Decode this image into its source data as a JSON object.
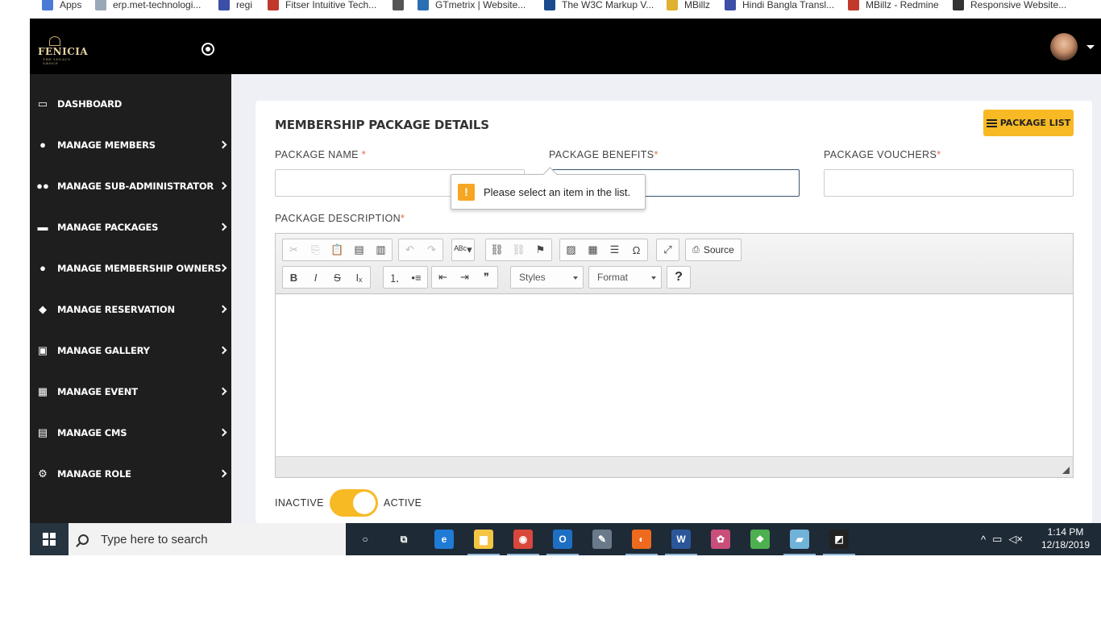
{
  "bookmarks": [
    {
      "label": "Apps",
      "icon": "apps-grid-icon",
      "color": "#4a7bd6"
    },
    {
      "label": "erp.met-technologi...",
      "icon": "page-icon",
      "color": "#9aa7b8"
    },
    {
      "label": "regi",
      "icon": "m-logo-icon",
      "color": "#3c4ea8"
    },
    {
      "label": "Fitser Intuitive Tech...",
      "icon": "redmine-icon",
      "color": "#c0392b"
    },
    {
      "label": "",
      "icon": "globe-icon",
      "color": "#555555"
    },
    {
      "label": "GTmetrix | Website...",
      "icon": "gtmetrix-icon",
      "color": "#2a6fb4"
    },
    {
      "label": "The W3C Markup V...",
      "icon": "w3c-icon",
      "color": "#1a4b8c"
    },
    {
      "label": "MBillz",
      "icon": "mbillz-icon",
      "color": "#e0b030"
    },
    {
      "label": "Hindi Bangla Transl...",
      "icon": "translate-icon",
      "color": "#3c4ea8"
    },
    {
      "label": "MBillz - Redmine",
      "icon": "redmine-icon",
      "color": "#c0392b"
    },
    {
      "label": "Responsive Website...",
      "icon": "responsive-icon",
      "color": "#333333"
    }
  ],
  "header": {
    "logo_text": "FENICIA",
    "logo_sub": "THE LEGACY GROUP"
  },
  "sidebar": {
    "items": [
      {
        "label": "DASHBOARD",
        "icon": "monitor-icon",
        "glyph": "▭",
        "has_arrow": false
      },
      {
        "label": "MANAGE MEMBERS",
        "icon": "user-icon",
        "glyph": "●",
        "has_arrow": true
      },
      {
        "label": "MANAGE SUB-ADMINISTRATOR",
        "icon": "users-icon",
        "glyph": "●●",
        "has_arrow": true
      },
      {
        "label": "MANAGE PACKAGES",
        "icon": "credit-card-icon",
        "glyph": "▬",
        "has_arrow": true
      },
      {
        "label": "MANAGE MEMBERSHIP OWNERS",
        "icon": "user-icon",
        "glyph": "●",
        "has_arrow": true
      },
      {
        "label": "MANAGE RESERVATION",
        "icon": "ticket-icon",
        "glyph": "◆",
        "has_arrow": true
      },
      {
        "label": "MANAGE GALLERY",
        "icon": "image-icon",
        "glyph": "▣",
        "has_arrow": true
      },
      {
        "label": "MANAGE EVENT",
        "icon": "calendar-icon",
        "glyph": "▦",
        "has_arrow": true
      },
      {
        "label": "MANAGE CMS",
        "icon": "file-icon",
        "glyph": "▤",
        "has_arrow": true
      },
      {
        "label": "MANAGE ROLE",
        "icon": "cogs-icon",
        "glyph": "⚙",
        "has_arrow": true
      }
    ]
  },
  "main": {
    "title": "MEMBERSHIP PACKAGE DETAILS",
    "package_list_label": "PACKAGE LIST",
    "fields": {
      "package_name": {
        "label": "PACKAGE NAME",
        "req": "*",
        "value": ""
      },
      "package_benefits": {
        "label": "PACKAGE BENEFITS",
        "req": "*",
        "value": ""
      },
      "package_vouchers": {
        "label": "PACKAGE VOUCHERS",
        "req": "*",
        "value": ""
      },
      "package_description": {
        "label": "PACKAGE DESCRIPTION",
        "req": "*"
      }
    },
    "validation_tooltip": "Please select an item in the list.",
    "editor": {
      "row1": [
        {
          "name": "cut-icon",
          "glyph": "✂",
          "disabled": true
        },
        {
          "name": "copy-icon",
          "glyph": "⎘",
          "disabled": true
        },
        {
          "name": "paste-icon",
          "glyph": "📋",
          "disabled": false
        },
        {
          "name": "paste-text-icon",
          "glyph": "▤",
          "disabled": false
        },
        {
          "name": "paste-word-icon",
          "glyph": "▥",
          "disabled": false
        },
        {
          "name": "undo-icon",
          "glyph": "↶",
          "disabled": true
        },
        {
          "name": "redo-icon",
          "glyph": "↷",
          "disabled": true
        },
        {
          "name": "spellcheck-icon",
          "glyph": "ᴬᴮᶜ▾",
          "disabled": false
        },
        {
          "name": "link-icon",
          "glyph": "⛓",
          "disabled": false
        },
        {
          "name": "unlink-icon",
          "glyph": "⛓",
          "disabled": true
        },
        {
          "name": "anchor-icon",
          "glyph": "⚑",
          "disabled": false
        },
        {
          "name": "image-icon",
          "glyph": "▨",
          "disabled": false
        },
        {
          "name": "table-icon",
          "glyph": "▦",
          "disabled": false
        },
        {
          "name": "horizontal-rule-icon",
          "glyph": "☰",
          "disabled": false
        },
        {
          "name": "special-char-icon",
          "glyph": "Ω",
          "disabled": false
        },
        {
          "name": "maximize-icon",
          "glyph": "⤢",
          "disabled": false
        }
      ],
      "source_label": "Source",
      "row2": [
        {
          "name": "bold-icon",
          "glyph": "B"
        },
        {
          "name": "italic-icon",
          "glyph": "I"
        },
        {
          "name": "strike-icon",
          "glyph": "S"
        },
        {
          "name": "remove-format-icon",
          "glyph": "Iₓ"
        },
        {
          "name": "numbered-list-icon",
          "glyph": "⒈"
        },
        {
          "name": "bulleted-list-icon",
          "glyph": "•≡"
        },
        {
          "name": "outdent-icon",
          "glyph": "⇤"
        },
        {
          "name": "indent-icon",
          "glyph": "⇥"
        },
        {
          "name": "blockquote-icon",
          "glyph": "❞"
        }
      ],
      "styles_label": "Styles",
      "format_label": "Format",
      "help_label": "?"
    },
    "status": {
      "inactive_label": "INACTIVE",
      "active_label": "ACTIVE",
      "is_active": true
    }
  },
  "taskbar": {
    "search_placeholder": "Type here to search",
    "apps": [
      {
        "name": "cortana-icon",
        "glyph": "○",
        "color": "transparent",
        "active": false
      },
      {
        "name": "task-view-icon",
        "glyph": "⧉",
        "color": "transparent",
        "active": false
      },
      {
        "name": "edge-icon",
        "glyph": "e",
        "color": "#1e7bd6",
        "active": false
      },
      {
        "name": "file-explorer-icon",
        "glyph": "▆",
        "color": "#f4c542",
        "active": true
      },
      {
        "name": "chrome-icon",
        "glyph": "◉",
        "color": "#d9473a",
        "active": true
      },
      {
        "name": "outlook-icon",
        "glyph": "O",
        "color": "#1e6fc4",
        "active": true
      },
      {
        "name": "paint-icon",
        "glyph": "✎",
        "color": "#6b7a8a",
        "active": false
      },
      {
        "name": "firefox-icon",
        "glyph": "◐",
        "color": "#ef6a1f",
        "active": true
      },
      {
        "name": "word-icon",
        "glyph": "W",
        "color": "#2b579a",
        "active": true
      },
      {
        "name": "paint-3d-icon",
        "glyph": "✿",
        "color": "#c94e7a",
        "active": false
      },
      {
        "name": "game-icon",
        "glyph": "❖",
        "color": "#4caf50",
        "active": false
      },
      {
        "name": "notepad-icon",
        "glyph": "▰",
        "color": "#6fb3d9",
        "active": true
      },
      {
        "name": "photos-icon",
        "glyph": "◩",
        "color": "#222222",
        "active": true
      }
    ],
    "time": "1:14 PM",
    "date": "12/18/2019"
  },
  "colors": {
    "accent": "#f7b924",
    "sidebar_bg": "#1e1e1e",
    "topbar_bg": "#000000"
  }
}
